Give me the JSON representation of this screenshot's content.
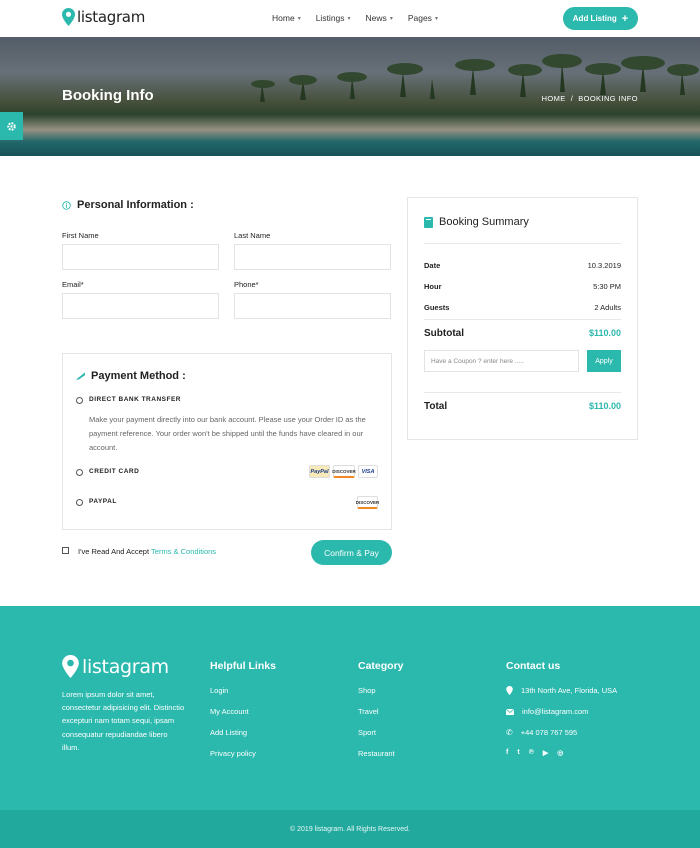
{
  "header": {
    "logo": "listagram",
    "nav": [
      {
        "label": "Home"
      },
      {
        "label": "Listings"
      },
      {
        "label": "News"
      },
      {
        "label": "Pages"
      }
    ],
    "add_listing": "Add Listing"
  },
  "hero": {
    "title": "Booking Info",
    "breadcrumb": [
      "HOME",
      "/",
      "BOOKING INFO"
    ]
  },
  "personal": {
    "title": "Personal Information :",
    "first_name_label": "First Name",
    "last_name_label": "Last Name",
    "email_label": "Email*",
    "phone_label": "Phone*"
  },
  "payment": {
    "title": "Payment Method :",
    "options": [
      {
        "label": "DIRECT BANK TRANSFER"
      },
      {
        "label": "CREDIT CARD"
      },
      {
        "label": "PAYPAL"
      }
    ],
    "description": "Make your payment directly into our bank account. Please use your Order ID as the payment reference. Your order won't be shipped until the funds have cleared in our account.",
    "cards": [
      "PayPal",
      "DISCOVER",
      "VISA"
    ],
    "paypal_card": "DISCOVER"
  },
  "terms": {
    "text": "I've Read And Accept",
    "link": "Terms & Conditions"
  },
  "confirm_label": "Confirm & Pay",
  "summary": {
    "title": "Booking Summary",
    "rows": [
      {
        "key": "Date",
        "value": "10.3.2019"
      },
      {
        "key": "Hour",
        "value": "5:30 PM"
      },
      {
        "key": "Guests",
        "value": "2 Adults"
      }
    ],
    "subtotal_label": "Subtotal",
    "subtotal_value": "$110.00",
    "coupon_placeholder": "Have a Coupon ? enter here .....",
    "apply_label": "Apply",
    "total_label": "Total",
    "total_value": "$110.00"
  },
  "footer": {
    "logo": "listagram",
    "about": "Lorem ipsum dolor sit amet, consectetur adipisicing elit. Distinctio excepturi nam totam sequi, ipsam consequatur repudiandae libero illum.",
    "helpful_title": "Helpful Links",
    "helpful_links": [
      "Login",
      "My Account",
      "Add Listing",
      "Privacy policy"
    ],
    "category_title": "Category",
    "categories": [
      "Shop",
      "Travel",
      "Sport",
      "Restaurant"
    ],
    "contact_title": "Contact us",
    "address": "13th North Ave, Florida, USA",
    "email": "info@listagram.com",
    "phone": "+44 078 767 595",
    "social": [
      "f",
      "t",
      "p",
      "yt",
      "dr"
    ],
    "copyright": "© 2019 listagram. All Rights Reserved."
  },
  "colors": {
    "accent": "#2bb8ad"
  }
}
